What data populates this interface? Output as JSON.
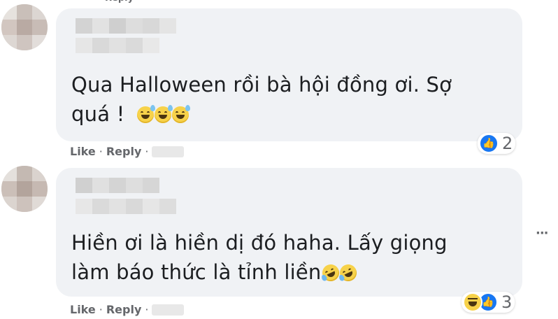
{
  "comments": [
    {
      "text_line1": "Qua Halloween rồi bà hội đồng ơi. Sợ",
      "text_line2": "quá !",
      "emojis": [
        "grinning-sweat-emoji",
        "grinning-sweat-emoji",
        "grinning-sweat-emoji"
      ],
      "actions": {
        "like": "Like",
        "reply": "Reply",
        "separator": "·"
      },
      "reaction_count": "2",
      "reactions": [
        "like"
      ]
    },
    {
      "text_line1": "Hiền ơi là hiền dị đó haha. Lấy giọng",
      "text_line2": "làm báo thức là tỉnh liền",
      "emojis": [
        "rolling-laughing-emoji",
        "rolling-laughing-emoji"
      ],
      "actions": {
        "like": "Like",
        "reply": "Reply",
        "separator": "·"
      },
      "reaction_count": "3",
      "reactions": [
        "haha",
        "like"
      ]
    }
  ],
  "more_options": "···",
  "colors": {
    "bubble": "#f0f2f5",
    "action_text": "#65676b",
    "like_blue": "#1877f2",
    "haha_yellow": "#f7d24a"
  }
}
